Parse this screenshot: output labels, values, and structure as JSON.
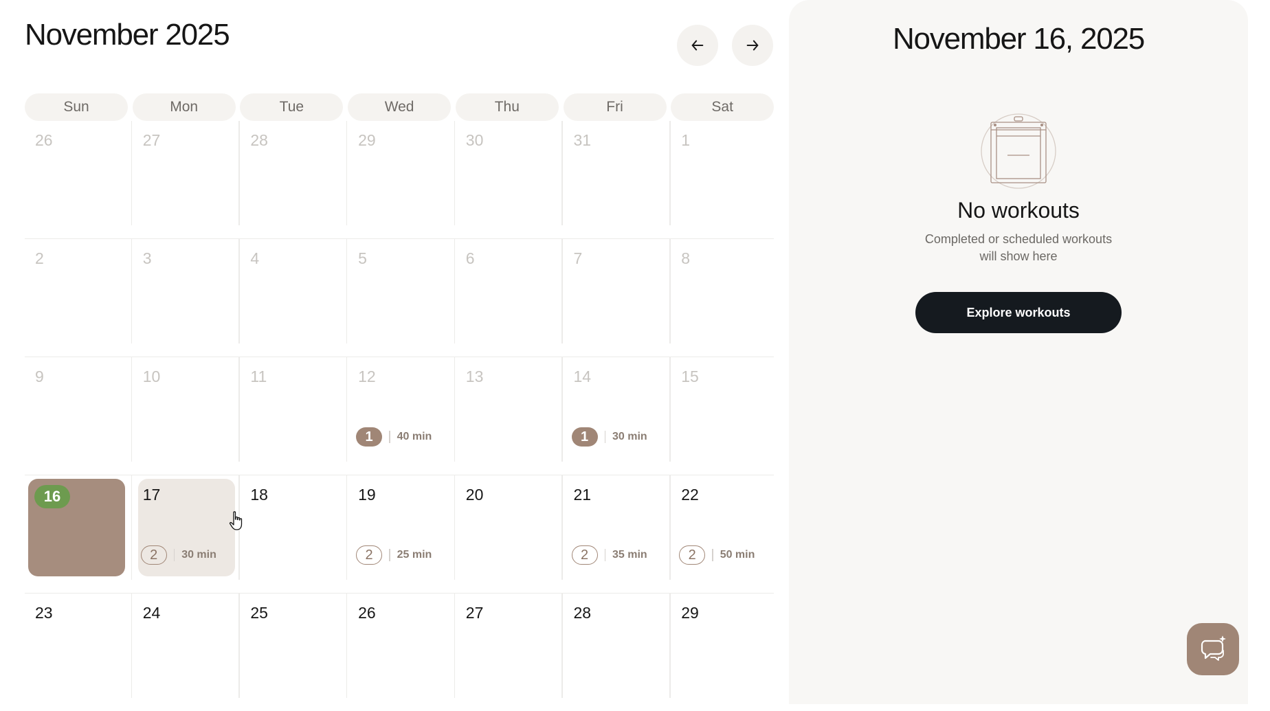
{
  "calendar": {
    "month_title": "November 2025",
    "prev_label": "Previous month",
    "next_label": "Next month",
    "weekdays": [
      "Sun",
      "Mon",
      "Tue",
      "Wed",
      "Thu",
      "Fri",
      "Sat"
    ],
    "weeks": [
      [
        {
          "day": "26",
          "state": "other"
        },
        {
          "day": "27",
          "state": "other"
        },
        {
          "day": "28",
          "state": "other"
        },
        {
          "day": "29",
          "state": "other"
        },
        {
          "day": "30",
          "state": "other"
        },
        {
          "day": "31",
          "state": "other"
        },
        {
          "day": "1",
          "state": "past"
        }
      ],
      [
        {
          "day": "2",
          "state": "past"
        },
        {
          "day": "3",
          "state": "past"
        },
        {
          "day": "4",
          "state": "past"
        },
        {
          "day": "5",
          "state": "past"
        },
        {
          "day": "6",
          "state": "past"
        },
        {
          "day": "7",
          "state": "past"
        },
        {
          "day": "8",
          "state": "past"
        }
      ],
      [
        {
          "day": "9",
          "state": "past"
        },
        {
          "day": "10",
          "state": "past"
        },
        {
          "day": "11",
          "state": "past"
        },
        {
          "day": "12",
          "state": "past",
          "count": "1",
          "duration": "40 min",
          "badge": "filled"
        },
        {
          "day": "13",
          "state": "past"
        },
        {
          "day": "14",
          "state": "past",
          "count": "1",
          "duration": "30 min",
          "badge": "filled"
        },
        {
          "day": "15",
          "state": "past"
        }
      ],
      [
        {
          "day": "16",
          "state": "today-selected"
        },
        {
          "day": "17",
          "state": "hovered",
          "count": "2",
          "duration": "30 min",
          "badge": "outline"
        },
        {
          "day": "18",
          "state": "current"
        },
        {
          "day": "19",
          "state": "current",
          "count": "2",
          "duration": "25 min",
          "badge": "outline"
        },
        {
          "day": "20",
          "state": "current"
        },
        {
          "day": "21",
          "state": "current",
          "count": "2",
          "duration": "35 min",
          "badge": "outline"
        },
        {
          "day": "22",
          "state": "current",
          "count": "2",
          "duration": "50 min",
          "badge": "outline"
        }
      ],
      [
        {
          "day": "23",
          "state": "current"
        },
        {
          "day": "24",
          "state": "current"
        },
        {
          "day": "25",
          "state": "current"
        },
        {
          "day": "26",
          "state": "current"
        },
        {
          "day": "27",
          "state": "current"
        },
        {
          "day": "28",
          "state": "current"
        },
        {
          "day": "29",
          "state": "current"
        }
      ]
    ]
  },
  "panel": {
    "selected_date": "November 16, 2025",
    "empty_title": "No workouts",
    "empty_subtitle_line1": "Completed or scheduled workouts",
    "empty_subtitle_line2": "will show here",
    "explore_label": "Explore workouts"
  },
  "icons": {
    "prev": "arrow-left-icon",
    "next": "arrow-right-icon",
    "empty": "clipboard-icon",
    "chat": "chat-assistant-icon"
  },
  "colors": {
    "selected_bg": "#a68d7e",
    "today_pill": "#6d9b4f",
    "hover_bg": "#ede8e3",
    "badge": "#a08676",
    "button_dark": "#151a1f",
    "panel_bg": "#f8f7f5"
  }
}
